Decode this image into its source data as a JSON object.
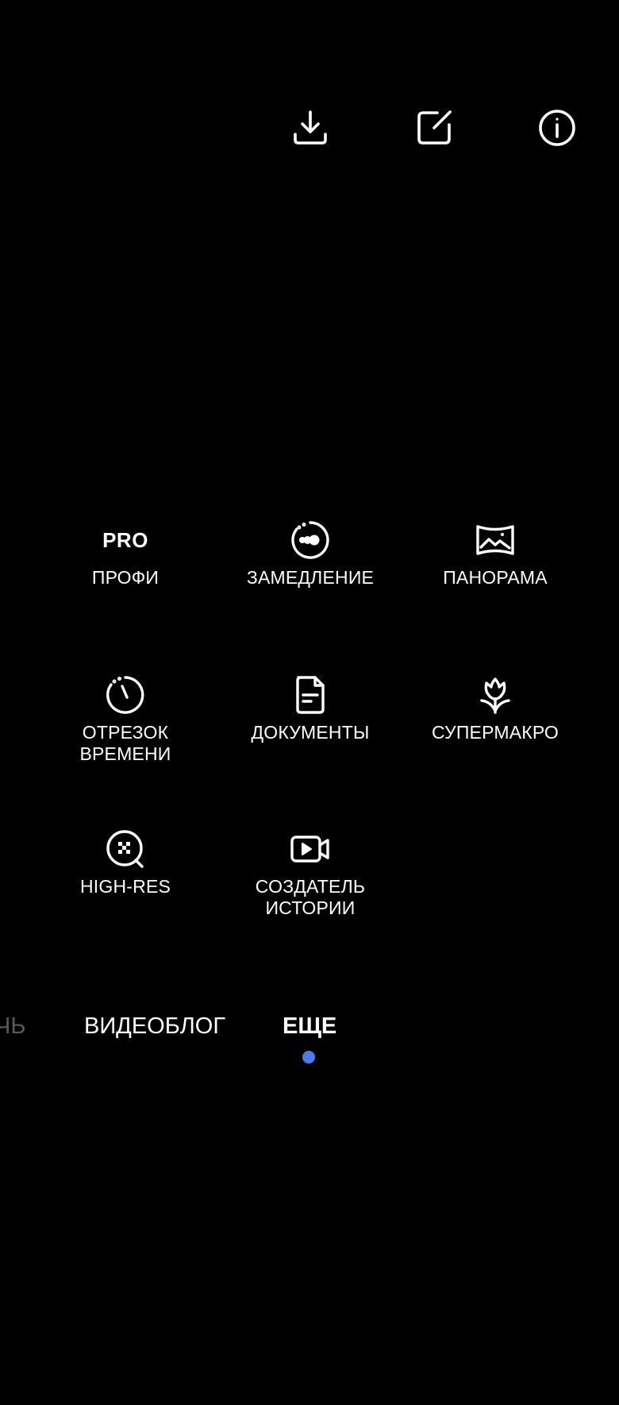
{
  "topbar": {
    "download_icon": "download-icon",
    "edit_icon": "edit-icon",
    "info_icon": "info-icon"
  },
  "modes": [
    {
      "label": "ПРОФИ",
      "icon_text": "PRO",
      "icon": "pro-icon"
    },
    {
      "label": "ЗАМЕДЛЕНИЕ",
      "icon": "slow-motion-icon"
    },
    {
      "label": "ПАНОРАМА",
      "icon": "panorama-icon"
    },
    {
      "label": "ОТРЕЗОК\nВРЕМЕНИ",
      "icon": "timer-icon"
    },
    {
      "label": "ДОКУМЕНТЫ",
      "icon": "document-icon"
    },
    {
      "label": "СУПЕРМАКРО",
      "icon": "flower-icon"
    },
    {
      "label": "HIGH-RES",
      "icon": "high-res-icon"
    },
    {
      "label": "СОЗДАТЕЛЬ\nИСТОРИИ",
      "icon": "story-video-icon"
    }
  ],
  "tabs": [
    {
      "label": "ЧЬ",
      "state": "faded"
    },
    {
      "label": "ВИДЕОБЛОГ",
      "state": "normal"
    },
    {
      "label": "ЕЩЕ",
      "state": "active"
    }
  ],
  "colors": {
    "background": "#000000",
    "foreground": "#ffffff",
    "accent": "#4f7bec",
    "faded": "#5a5a5a"
  }
}
